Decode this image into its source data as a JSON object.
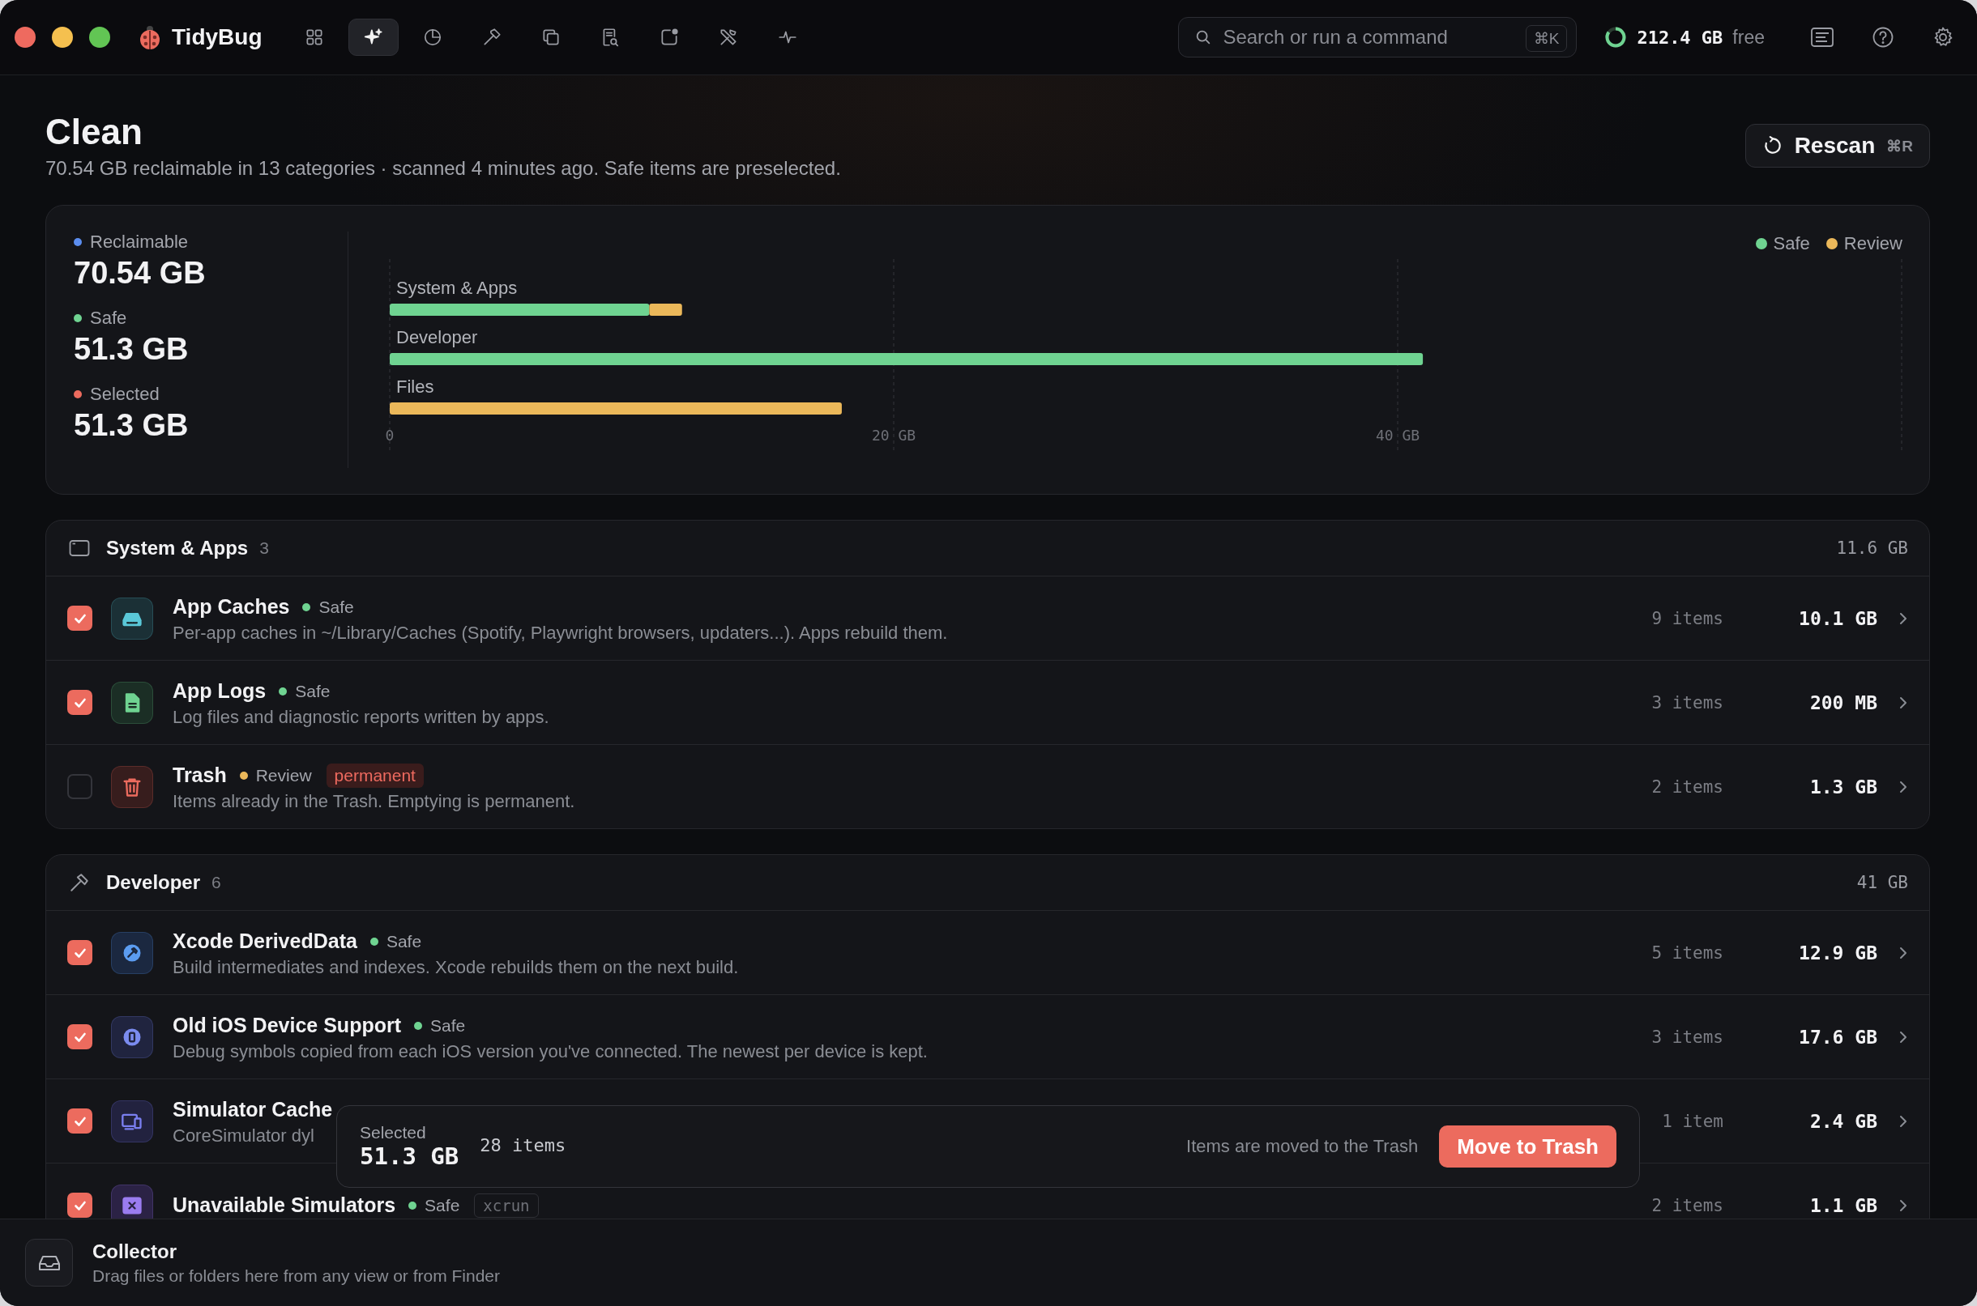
{
  "window": {
    "app_name": "TidyBug"
  },
  "nav": [
    {
      "selected": false
    },
    {
      "selected": true
    },
    {
      "selected": false
    },
    {
      "selected": false
    },
    {
      "selected": false
    },
    {
      "selected": false
    },
    {
      "selected": false
    },
    {
      "selected": false
    },
    {
      "selected": false
    }
  ],
  "search": {
    "placeholder": "Search or run a command",
    "shortcut": "⌘K"
  },
  "disk": {
    "free": "212.4 GB",
    "suffix": "free"
  },
  "page": {
    "title": "Clean",
    "subtitle": "70.54 GB reclaimable in 13 categories · scanned 4 minutes ago. Safe items are preselected.",
    "rescan": {
      "label": "Rescan",
      "shortcut": "⌘R"
    }
  },
  "summary": {
    "stats": [
      {
        "label": "Reclaimable",
        "value": "70.54 GB",
        "color": "#5b8def"
      },
      {
        "label": "Safe",
        "value": "51.3 GB",
        "color": "#6fd391"
      },
      {
        "label": "Selected",
        "value": "51.3 GB",
        "color": "#ec6b5e"
      }
    ],
    "chart_data": {
      "type": "bar",
      "orientation": "horizontal",
      "stacked": true,
      "categories": [
        "System & Apps",
        "Developer",
        "Files"
      ],
      "series": [
        {
          "name": "Safe",
          "color": "#6fd391",
          "values": [
            10.3,
            41,
            0
          ]
        },
        {
          "name": "Review",
          "color": "#ebb85a",
          "values": [
            1.3,
            0,
            17.94
          ]
        }
      ],
      "legend": true,
      "xlim": [
        0,
        60
      ],
      "xticks": [
        {
          "value": 0,
          "label": "0"
        },
        {
          "value": 20,
          "label": "20 GB"
        },
        {
          "value": 40,
          "label": "40 GB"
        }
      ]
    }
  },
  "sections": [
    {
      "name": "System & Apps",
      "count": "3",
      "total": "11.6 GB",
      "rows": [
        {
          "checked": true,
          "title": "App Caches",
          "status": {
            "label": "Safe",
            "color": "#6fd391"
          },
          "description": "Per-app caches in ~/Library/Caches (Spotify, Playwright browsers, updaters...). Apps rebuild them.",
          "items": "9 items",
          "size": "10.1 GB"
        },
        {
          "checked": true,
          "title": "App Logs",
          "status": {
            "label": "Safe",
            "color": "#6fd391"
          },
          "description": "Log files and diagnostic reports written by apps.",
          "items": "3 items",
          "size": "200 MB"
        },
        {
          "checked": false,
          "title": "Trash",
          "status": {
            "label": "Review",
            "color": "#ebb85a"
          },
          "tag": {
            "text": "permanent",
            "kind": "warning"
          },
          "description": "Items already in the Trash. Emptying is permanent.",
          "items": "2 items",
          "size": "1.3 GB"
        }
      ]
    },
    {
      "name": "Developer",
      "count": "6",
      "total": "41 GB",
      "rows": [
        {
          "checked": true,
          "title": "Xcode DerivedData",
          "status": {
            "label": "Safe",
            "color": "#6fd391"
          },
          "description": "Build intermediates and indexes. Xcode rebuilds them on the next build.",
          "items": "5 items",
          "size": "12.9 GB"
        },
        {
          "checked": true,
          "title": "Old iOS Device Support",
          "status": {
            "label": "Safe",
            "color": "#6fd391"
          },
          "description": "Debug symbols copied from each iOS version you've connected. The newest per device is kept.",
          "items": "3 items",
          "size": "17.6 GB"
        },
        {
          "checked": true,
          "title": "Simulator Cache",
          "description": "CoreSimulator dyl",
          "items": "1 item",
          "size": "2.4 GB"
        },
        {
          "checked": true,
          "title": "Unavailable Simulators",
          "status": {
            "label": "Safe",
            "color": "#6fd391"
          },
          "tag": {
            "text": "xcrun",
            "kind": "tool"
          },
          "items": "2 items",
          "size": "1.1 GB"
        }
      ]
    }
  ],
  "selection_bar": {
    "label": "Selected",
    "value": "51.3 GB",
    "count": "28 items",
    "note": "Items are moved to the Trash",
    "button": "Move to Trash"
  },
  "collector": {
    "title": "Collector",
    "description": "Drag files or folders here from any view or from Finder"
  }
}
